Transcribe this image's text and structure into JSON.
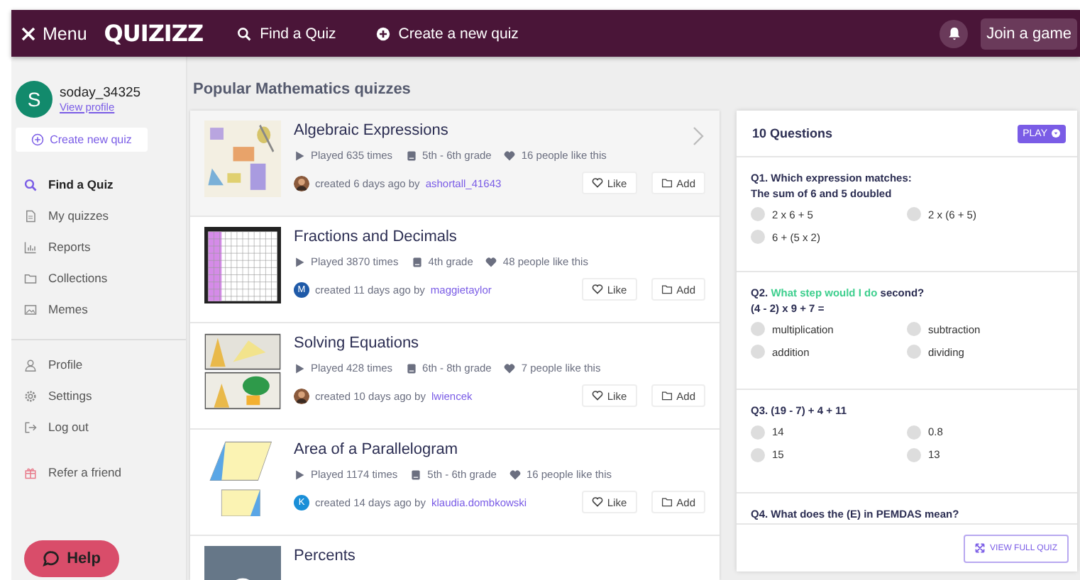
{
  "header": {
    "menu_label": "Menu",
    "logo": "QUIZIZZ",
    "links": [
      {
        "label": "Find a Quiz"
      },
      {
        "label": "Create a new quiz"
      }
    ],
    "join_button": "Join a game"
  },
  "sidebar": {
    "user": {
      "initial": "S",
      "name": "soday_34325",
      "profile_link": "View profile"
    },
    "create_button": "Create new quiz",
    "items": [
      {
        "label": "Find a Quiz",
        "selected": true
      },
      {
        "label": "My quizzes",
        "selected": false
      },
      {
        "label": "Reports",
        "selected": false
      },
      {
        "label": "Collections",
        "selected": false
      },
      {
        "label": "Memes",
        "selected": false
      }
    ],
    "account_items": [
      {
        "label": "Profile"
      },
      {
        "label": "Settings"
      },
      {
        "label": "Log out"
      }
    ],
    "refer": "Refer a friend",
    "help_button": "Help"
  },
  "section_title": "Popular Mathematics quizzes",
  "quizzes": [
    {
      "title": "Algebraic Expressions",
      "hovered": true,
      "played": "Played 635 times",
      "grade": "5th - 6th grade",
      "likes": "16 people like this",
      "created": "created 6 days ago by",
      "author": "ashortall_41643",
      "like_button": "Like",
      "add_button": "Add"
    },
    {
      "title": "Fractions and Decimals",
      "hovered": false,
      "played": "Played 3870 times",
      "grade": "4th grade",
      "likes": "48 people like this",
      "created": "created 11 days ago by",
      "author": "maggietaylor",
      "avatar": {
        "kind": "letter",
        "letter": "M",
        "color": "#1f5aa8"
      },
      "like_button": "Like",
      "add_button": "Add"
    },
    {
      "title": "Solving Equations",
      "hovered": false,
      "played": "Played 428 times",
      "grade": "6th - 8th grade",
      "likes": "7 people like this",
      "created": "created 10 days ago by",
      "author": "lwiencek",
      "like_button": "Like",
      "add_button": "Add"
    },
    {
      "title": "Area of a Parallelogram",
      "hovered": false,
      "played": "Played 1174 times",
      "grade": "5th - 6th grade",
      "likes": "16 people like this",
      "created": "created 14 days ago by",
      "author": "klaudia.dombkowski",
      "avatar": {
        "kind": "letter",
        "letter": "K",
        "color": "#1a8fd8"
      },
      "like_button": "Like",
      "add_button": "Add"
    },
    {
      "title": "Percents",
      "hovered": false
    }
  ],
  "preview": {
    "title": "10 Questions",
    "play_button": "PLAY",
    "questions": [
      {
        "parts": [
          {
            "text": "Q1. Which expression matches:",
            "highlight": false
          }
        ],
        "line2": "The sum of 6 and 5 doubled",
        "options": [
          {
            "text": "2 x 6 + 5",
            "selected": false
          },
          {
            "text": "2 x (6 + 5)",
            "selected": false
          },
          {
            "text": "6 + (5 x 2)",
            "selected": false
          }
        ]
      },
      {
        "parts": [
          {
            "text": "Q2. ",
            "highlight": false
          },
          {
            "text": "What step would I do",
            "highlight": true
          },
          {
            "text": " second?",
            "highlight": false
          }
        ],
        "line2": "(4 - 2) x 9 + 7 =",
        "options": [
          {
            "text": "multiplication",
            "selected": false
          },
          {
            "text": "subtraction",
            "selected": false
          },
          {
            "text": "addition",
            "selected": false
          },
          {
            "text": "dividing",
            "selected": false
          }
        ]
      },
      {
        "parts": [
          {
            "text": "Q3. (19 - 7) + 4 + 11",
            "highlight": false
          }
        ],
        "options": [
          {
            "text": "14",
            "selected": false
          },
          {
            "text": "0.8",
            "selected": false
          },
          {
            "text": "15",
            "selected": false
          },
          {
            "text": "13",
            "selected": false
          }
        ]
      },
      {
        "parts": [
          {
            "text": "Q4. What does the (E) in PEMDAS mean?",
            "highlight": false
          }
        ]
      }
    ],
    "view_button": "VIEW FULL QUIZ"
  }
}
